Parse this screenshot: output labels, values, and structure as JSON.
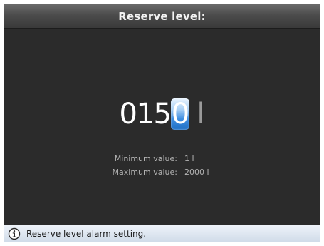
{
  "header": {
    "title": "Reserve level:"
  },
  "value_editor": {
    "digits": [
      "0",
      "1",
      "5"
    ],
    "active_digit": "0",
    "unit": "l"
  },
  "limits": {
    "minimum_label": "Minimum value:",
    "minimum_value": "1 l",
    "maximum_label": "Maximum value:",
    "maximum_value": "2000 l"
  },
  "status_bar": {
    "icon": "info-icon",
    "message": "Reserve level alarm setting."
  },
  "colors": {
    "screen_background": "#2b2b2b",
    "header": "#4c4c4c",
    "cursor_accent": "#3f8ee0",
    "status_bar": "#cfdbe8"
  }
}
